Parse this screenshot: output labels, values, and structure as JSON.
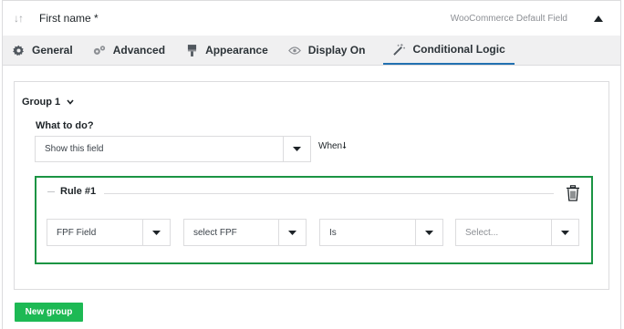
{
  "field": {
    "sort_icon": "↓↑",
    "title": "First name *",
    "type": "WooCommerce Default Field"
  },
  "tabs": [
    {
      "label": "General",
      "icon": "gear-icon"
    },
    {
      "label": "Advanced",
      "icon": "gears-icon"
    },
    {
      "label": "Appearance",
      "icon": "brush-icon"
    },
    {
      "label": "Display On",
      "icon": "eye-icon"
    },
    {
      "label": "Conditional Logic",
      "icon": "magic-wand-icon",
      "active": true
    }
  ],
  "group": {
    "title": "Group 1",
    "what_to_do_label": "What to do?",
    "action_value": "Show this field",
    "when_label": "When⭣"
  },
  "rule": {
    "title": "Rule #1",
    "field_source": "FPF Field",
    "field_select": "select FPF",
    "operator": "Is",
    "value_placeholder": "Select..."
  },
  "buttons": {
    "new_group": "New group"
  },
  "colors": {
    "accent": "#2271b1",
    "rule_border": "#1a9443",
    "new_group_button": "#1db954"
  }
}
